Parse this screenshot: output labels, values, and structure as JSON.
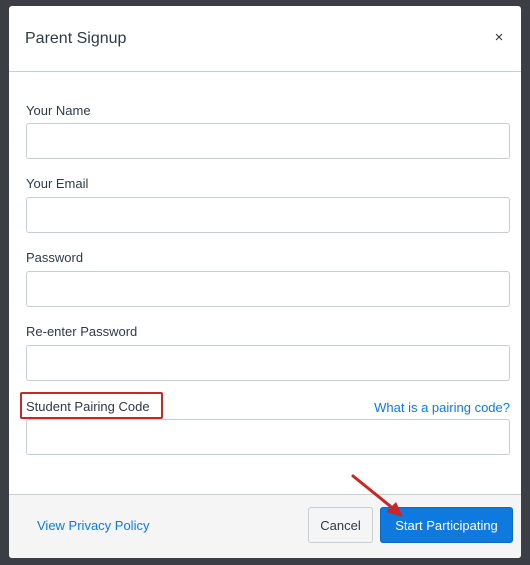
{
  "dialog": {
    "title": "Parent Signup",
    "close_label": "×"
  },
  "form": {
    "name_label": "Your Name",
    "name_value": "",
    "email_label": "Your Email",
    "email_value": "",
    "password_label": "Password",
    "password_value": "",
    "reenter_password_label": "Re-enter Password",
    "reenter_password_value": "",
    "pairing_code_label": "Student Pairing Code",
    "pairing_code_value": "",
    "pairing_help_link": "What is a pairing code?"
  },
  "footer": {
    "privacy_link": "View Privacy Policy",
    "cancel_label": "Cancel",
    "submit_label": "Start Participating"
  },
  "colors": {
    "accent": "#0e7ae0",
    "annotation": "#c62828",
    "backdrop": "#3b3f45"
  }
}
